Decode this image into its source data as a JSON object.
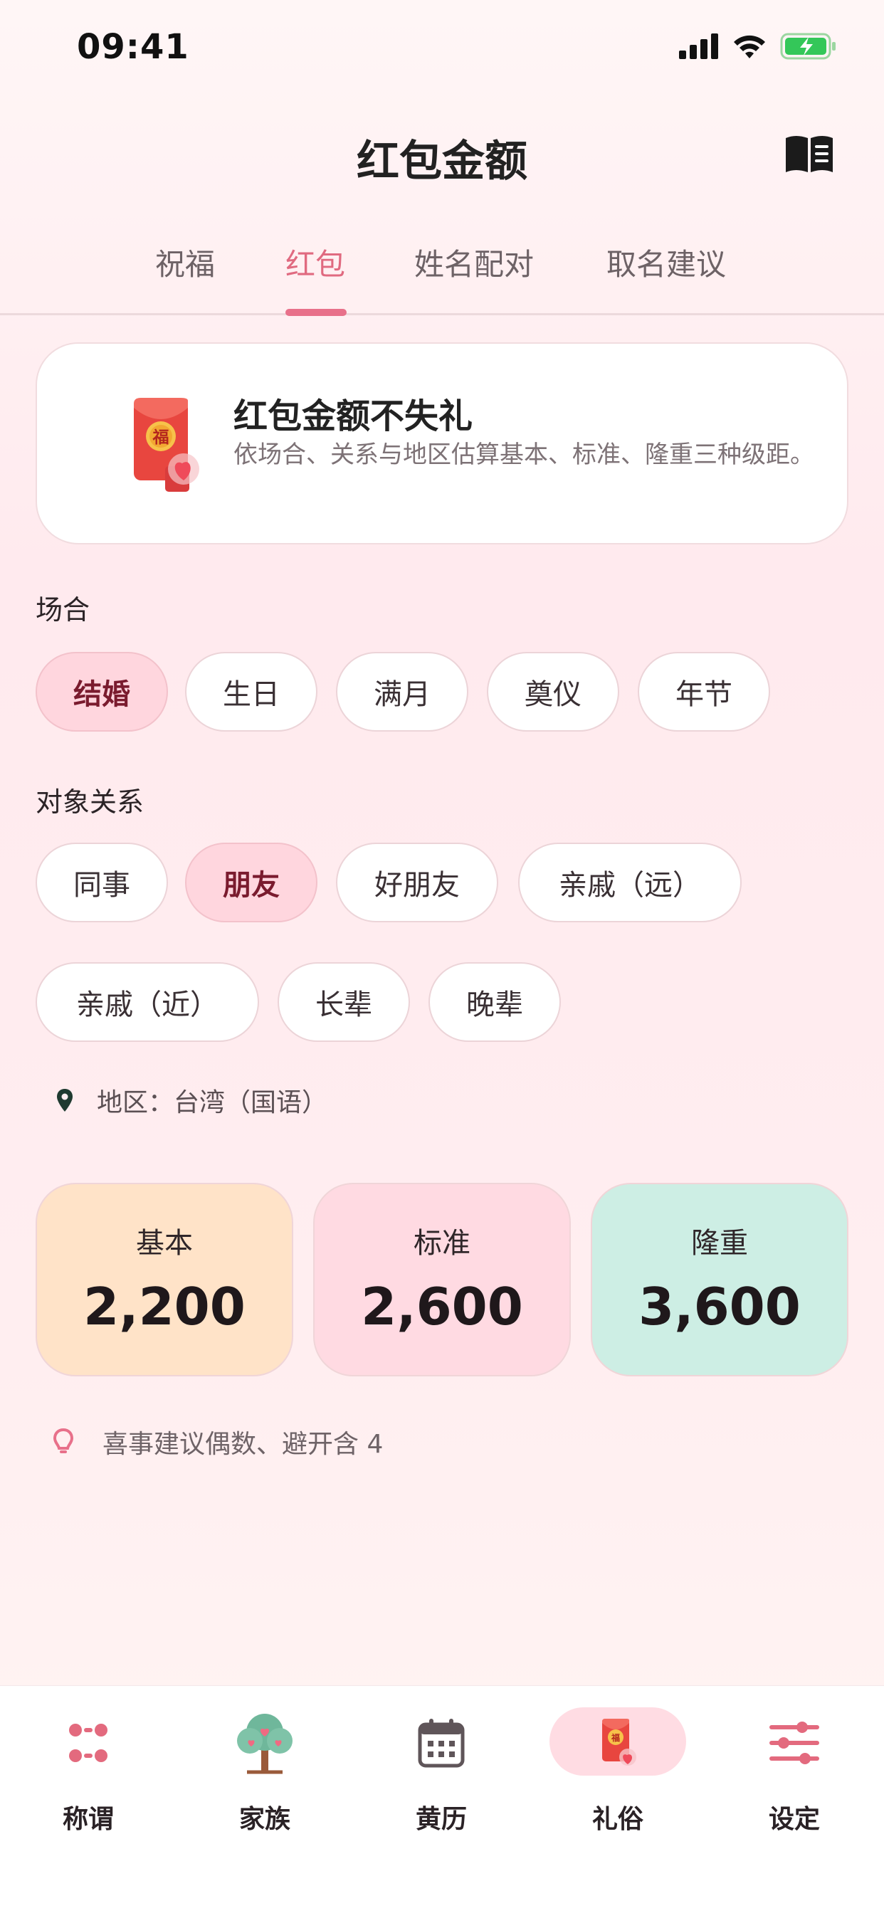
{
  "status": {
    "time": "09:41"
  },
  "header": {
    "title": "红包金额"
  },
  "tabs": [
    {
      "label": "祝福"
    },
    {
      "label": "红包"
    },
    {
      "label": "姓名配对"
    },
    {
      "label": "取名建议"
    }
  ],
  "hero": {
    "title": "红包金额不失礼",
    "description": "依场合、关系与地区估算基本、标准、隆重三种级距。",
    "illustration_text": "福"
  },
  "occasion": {
    "label": "场合",
    "options": [
      "结婚",
      "生日",
      "满月",
      "奠仪",
      "年节"
    ],
    "selected": "结婚"
  },
  "relation": {
    "label": "对象关系",
    "options": [
      "同事",
      "朋友",
      "好朋友",
      "亲戚（远）",
      "亲戚（近）",
      "长辈",
      "晚辈"
    ],
    "selected": "朋友"
  },
  "region": {
    "text": "地区：台湾（国语）"
  },
  "amounts": [
    {
      "label": "基本",
      "value": "2,200",
      "color": "#ffe3c8"
    },
    {
      "label": "标准",
      "value": "2,600",
      "color": "#ffdae2"
    },
    {
      "label": "隆重",
      "value": "3,600",
      "color": "#cdeee4"
    }
  ],
  "tip": {
    "text": "喜事建议偶数、避开含 4"
  },
  "nav": [
    {
      "label": "称谓",
      "icon": "dots-grid-icon"
    },
    {
      "label": "家族",
      "icon": "family-tree-icon"
    },
    {
      "label": "黄历",
      "icon": "calendar-icon"
    },
    {
      "label": "礼俗",
      "icon": "red-envelope-icon",
      "active": true
    },
    {
      "label": "设定",
      "icon": "sliders-icon"
    }
  ],
  "colors": {
    "accent": "#e06a80",
    "selected_chip": "#ffd6de"
  }
}
